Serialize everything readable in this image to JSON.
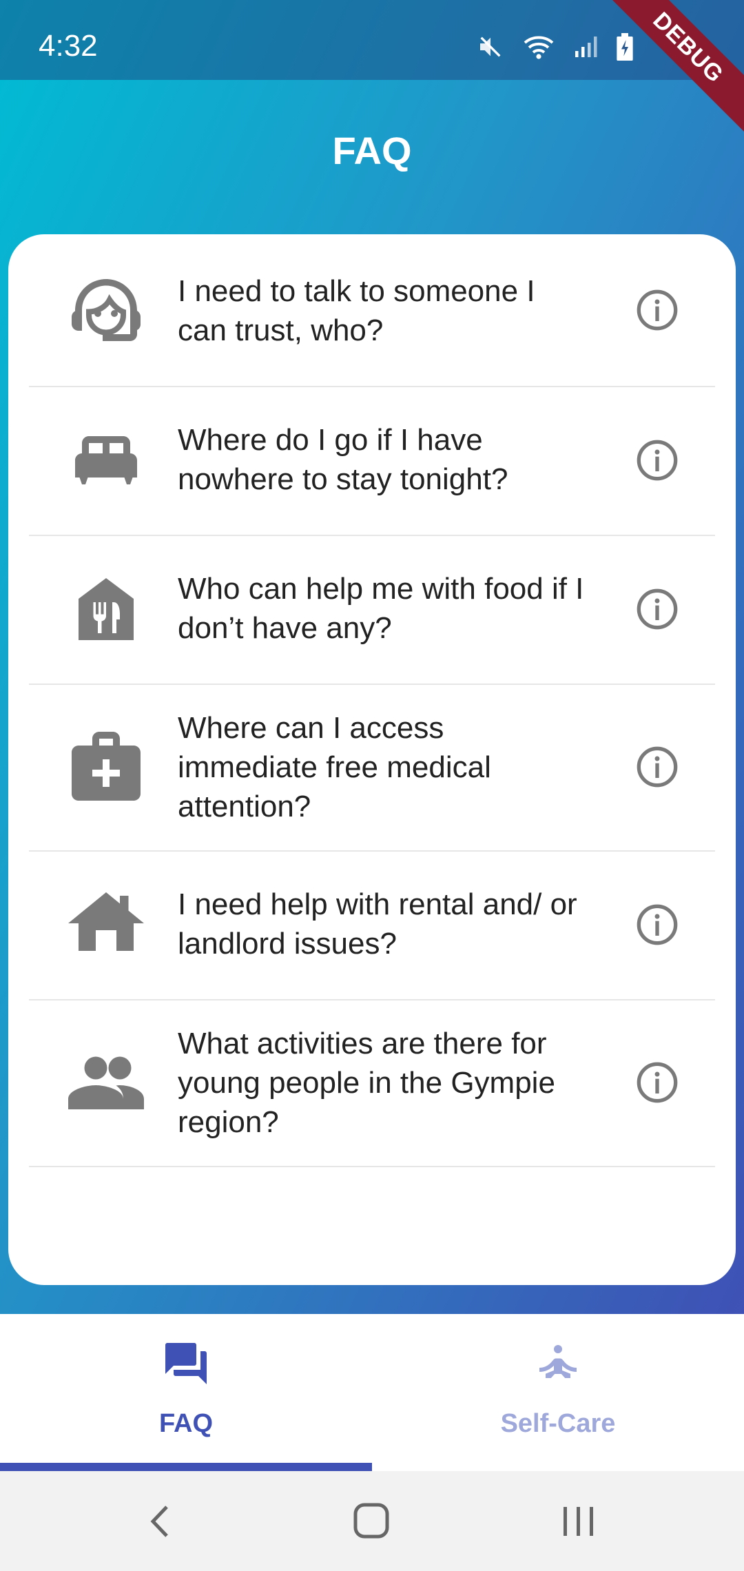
{
  "status_bar": {
    "time": "4:32",
    "debug_label": "DEBUG"
  },
  "page": {
    "title": "FAQ"
  },
  "faq": {
    "items": [
      {
        "icon": "support-agent-icon",
        "question": "I need to talk to someone I can trust, who?"
      },
      {
        "icon": "bed-icon",
        "question": "Where do I go if I have nowhere to stay tonight?"
      },
      {
        "icon": "food-house-icon",
        "question": "Who can help me with food if I don’t have any?"
      },
      {
        "icon": "medical-kit-icon",
        "question": "Where can I access immediate free medical attention?"
      },
      {
        "icon": "house-icon",
        "question": "I need help with rental and/ or landlord issues?"
      },
      {
        "icon": "people-icon",
        "question": "What activities are there for young people in the Gympie region?"
      }
    ]
  },
  "bottom_nav": {
    "tabs": [
      {
        "label": "FAQ",
        "icon": "forum-icon",
        "active": true
      },
      {
        "label": "Self-Care",
        "icon": "meditation-icon",
        "active": false
      }
    ],
    "active_color": "#3f51b5",
    "inactive_color": "#9fa8da"
  },
  "colors": {
    "gradient_start": "#00bcd4",
    "gradient_end": "#3f51b5",
    "icon_gray": "#7a7a7a"
  }
}
